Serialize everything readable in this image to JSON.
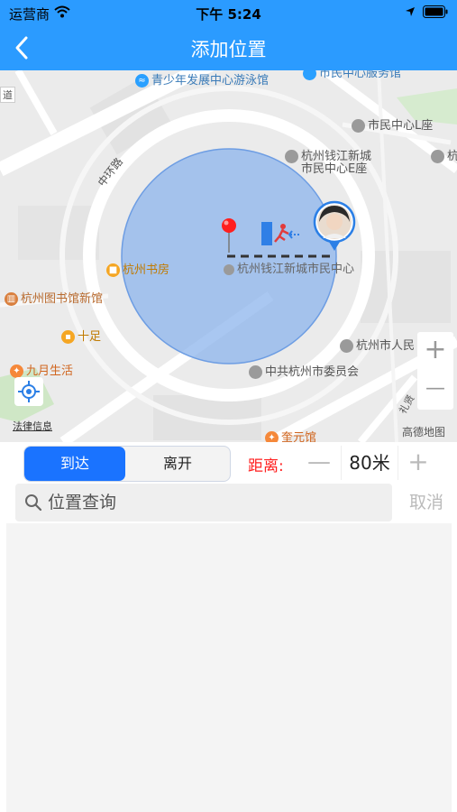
{
  "status_bar": {
    "carrier": "运营商",
    "time": "下午 5:24"
  },
  "nav": {
    "title": "添加位置"
  },
  "map": {
    "labels": {
      "youth_pool": "青少年发展中心游泳馆",
      "citizen_center_top": "市民中心服务馆",
      "citizen_center_l": "市民中心L座",
      "e_block_line1": "杭州钱江新城",
      "e_block_line2": "市民中心E座",
      "road_zhonghuan": "中环路",
      "road_dao": "道",
      "bookstore": "杭州书房",
      "center_poi": "杭州钱江新城市民中心",
      "library": "杭州图书馆新馆",
      "shizu": "十足",
      "jiuyue": "九月生活",
      "hz_people": "杭州市人民",
      "cpc": "中共杭州市委员会",
      "kuiyuan": "奎元馆",
      "legal": "法律信息",
      "gaode": "高德地图",
      "road_right": "礼贤",
      "edge_hang": "杭"
    },
    "zoom_in": "+",
    "zoom_out": "—"
  },
  "controls": {
    "arrive_label": "到达",
    "leave_label": "离开",
    "distance_label": "距离:",
    "minus": "—",
    "distance_value": "80米",
    "plus": "+"
  },
  "search": {
    "placeholder": "位置查询",
    "cancel_label": "取消"
  },
  "colors": {
    "nav": "#2b9bff",
    "accent": "#1a73ff",
    "radius_fill": "#8cb4ec",
    "distance_label": "#ff2020"
  }
}
